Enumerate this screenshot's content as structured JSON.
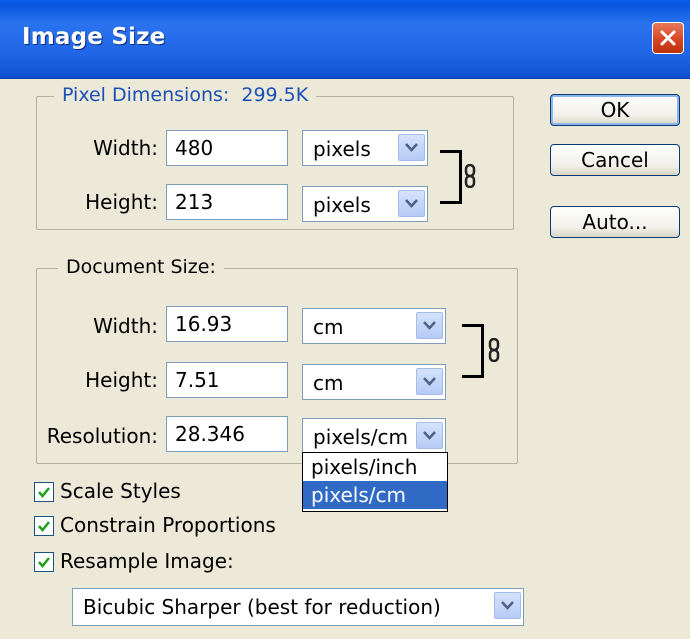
{
  "window": {
    "title": "Image Size"
  },
  "pixel_dimensions": {
    "legend_label": "Pixel Dimensions:",
    "size": "299.5K",
    "width_label": "Width:",
    "width_value": "480",
    "width_unit": "pixels",
    "height_label": "Height:",
    "height_value": "213",
    "height_unit": "pixels"
  },
  "document_size": {
    "legend_label": "Document Size:",
    "width_label": "Width:",
    "width_value": "16.93",
    "width_unit": "cm",
    "height_label": "Height:",
    "height_value": "7.51",
    "height_unit": "cm",
    "resolution_label": "Resolution:",
    "resolution_value": "28.346",
    "resolution_unit": "pixels/cm",
    "resolution_options": [
      "pixels/inch",
      "pixels/cm"
    ]
  },
  "buttons": {
    "ok": "OK",
    "cancel": "Cancel",
    "auto": "Auto..."
  },
  "options": {
    "scale_styles": {
      "label": "Scale Styles",
      "checked": true
    },
    "constrain_proportions": {
      "label": "Constrain Proportions",
      "checked": true
    },
    "resample_image": {
      "label": "Resample Image:",
      "checked": true
    }
  },
  "resample_method": "Bicubic Sharper (best for reduction)",
  "icons": [
    "close-icon",
    "chain-link-icon",
    "chevron-down-icon",
    "checkmark-icon"
  ],
  "colors": {
    "titlebar": "#1f65e6",
    "dialog_bg": "#ece9d8",
    "selection": "#316ac5",
    "legend_blue": "#1b4fb8"
  }
}
